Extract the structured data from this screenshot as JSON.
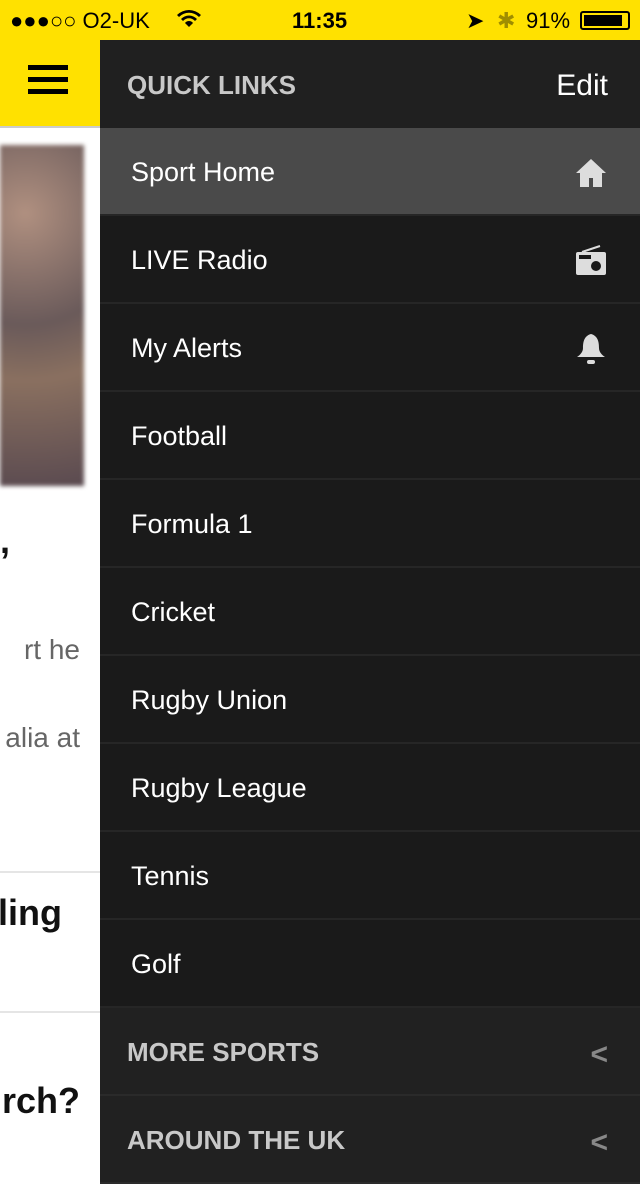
{
  "status": {
    "carrier": "●●●○○ O2-UK",
    "time": "11:35",
    "battery": "91%"
  },
  "background": {
    "fragments": [
      ",",
      "rt he",
      "alia at",
      "ling",
      "rch?"
    ]
  },
  "menu": {
    "title": "QUICK LINKS",
    "edit": "Edit",
    "items": [
      {
        "label": "Sport Home",
        "icon": "home-icon"
      },
      {
        "label": "LIVE Radio",
        "icon": "radio-icon"
      },
      {
        "label": "My Alerts",
        "icon": "bell-icon"
      },
      {
        "label": "Football"
      },
      {
        "label": "Formula 1"
      },
      {
        "label": "Cricket"
      },
      {
        "label": "Rugby Union"
      },
      {
        "label": "Rugby League"
      },
      {
        "label": "Tennis"
      },
      {
        "label": "Golf"
      }
    ],
    "sections": [
      {
        "label": "MORE SPORTS"
      },
      {
        "label": "AROUND THE UK"
      }
    ]
  },
  "colors": {
    "accent": "#ffe100",
    "menu_bg": "#1a1a1a",
    "active": "#4a4a4a"
  }
}
